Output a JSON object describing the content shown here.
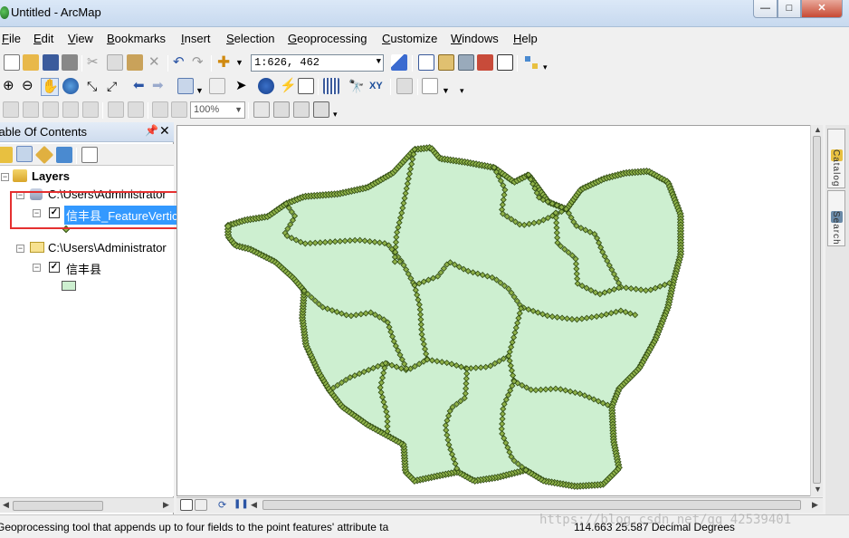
{
  "window": {
    "title": "Untitled - ArcMap",
    "controls": {
      "minimize": "—",
      "maximize": "□",
      "close": "✕"
    }
  },
  "menu": [
    {
      "label": "File",
      "key": "F"
    },
    {
      "label": "Edit",
      "key": "E"
    },
    {
      "label": "View",
      "key": "V"
    },
    {
      "label": "Bookmarks",
      "key": "B"
    },
    {
      "label": "Insert",
      "key": "I"
    },
    {
      "label": "Selection",
      "key": "S"
    },
    {
      "label": "Geoprocessing",
      "key": "G"
    },
    {
      "label": "Customize",
      "key": "C"
    },
    {
      "label": "Windows",
      "key": "W"
    },
    {
      "label": "Help",
      "key": "H"
    }
  ],
  "toolbar": {
    "scale": "1:626, 462",
    "zoom": "100%",
    "icons": [
      "new-document-icon",
      "open-folder-icon",
      "save-icon",
      "print-icon",
      "cut-icon",
      "copy-icon",
      "paste-icon",
      "delete-icon",
      "undo-icon",
      "redo-icon",
      "add-data-icon",
      "editor-icon",
      "table-icon",
      "catalog-icon",
      "arctoolbox-icon",
      "python-icon",
      "model-builder-icon",
      "zoom-in-icon",
      "zoom-out-icon",
      "pan-icon",
      "full-extent-icon",
      "fixed-zoom-in-icon",
      "fixed-zoom-out-icon",
      "back-extent-icon",
      "forward-extent-icon",
      "select-features-icon",
      "clear-selection-icon",
      "select-elements-icon",
      "identify-icon",
      "hyperlink-icon",
      "html-popup-icon",
      "measure-icon",
      "find-icon",
      "go-to-xy-icon",
      "time-slider-icon",
      "viewer-window-icon"
    ]
  },
  "toc": {
    "title": "Table Of Contents",
    "pin": "📌",
    "close": "✕",
    "root": "Layers",
    "groups": [
      {
        "path": "C:\\Users\\Administrator",
        "layer": "信丰县_FeatureVertic",
        "selected": true,
        "checked": "✓"
      },
      {
        "path": "C:\\Users\\Administrator",
        "layer": "信丰县",
        "selected": false,
        "checked": "✓"
      }
    ],
    "expanded_glyph": "−"
  },
  "side_tabs": [
    "Catalog",
    "Search"
  ],
  "statusbar": {
    "message": "Geoprocessing tool that appends up to four fields to the point features' attribute ta",
    "coords": "114.663  25.587 Decimal Degrees"
  },
  "watermark": "https://blog.csdn.net/qq_42539401",
  "colors": {
    "polygon_fill": "#cdefd0",
    "vertex_fill": "#8fb24a",
    "vertex_stroke": "#2f4a12",
    "selection": "#3399ff",
    "highlight_box": "#e53030"
  }
}
